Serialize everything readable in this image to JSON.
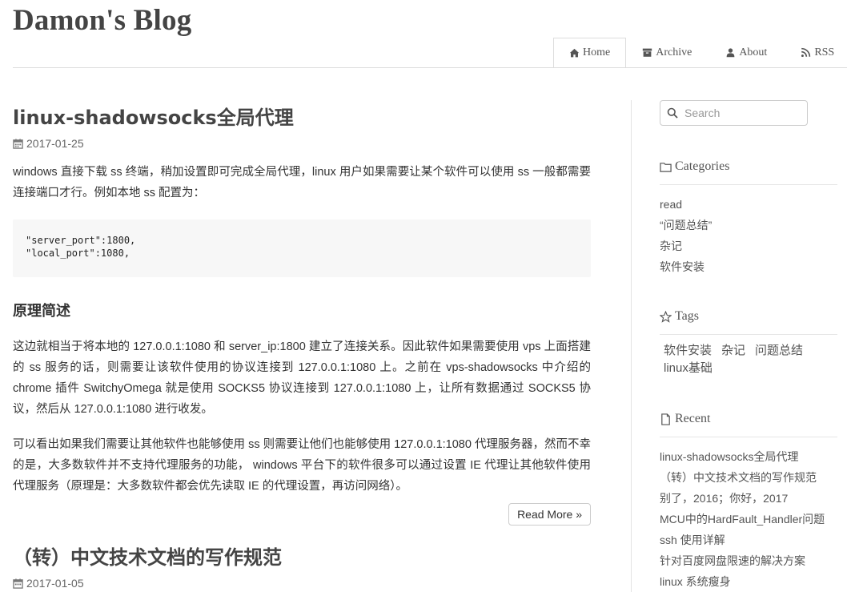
{
  "site": {
    "title": "Damon's Blog"
  },
  "nav": {
    "home": "Home",
    "archive": "Archive",
    "about": "About",
    "rss": "RSS"
  },
  "posts": [
    {
      "title": "linux-shadowsocks全局代理",
      "date": "2017-01-25",
      "intro": "windows 直接下载 ss 终端，稍加设置即可完成全局代理，linux 用户如果需要让某个软件可以使用 ss 一般都需要连接端口才行。例如本地 ss 配置为：",
      "code": "\"server_port\":1800,\n\"local_port\":1080,",
      "section_heading": "原理简述",
      "para2": "这边就相当于将本地的 127.0.0.1:1080 和 server_ip:1800 建立了连接关系。因此软件如果需要使用 vps 上面搭建的 ss 服务的话，则需要让该软件使用的协议连接到 127.0.0.1:1080 上。之前在 vps-shadowsocks 中介绍的 chrome 插件 SwitchyOmega 就是使用 SOCKS5 协议连接到 127.0.0.1:1080 上，让所有数据通过 SOCKS5 协议，然后从 127.0.0.1:1080 进行收发。",
      "para3": "可以看出如果我们需要让其他软件也能够使用 ss 则需要让他们也能够使用 127.0.0.1:1080 代理服务器，然而不幸的是，大多数软件并不支持代理服务的功能， windows 平台下的软件很多可以通过设置 IE 代理让其他软件使用代理服务（原理是：大多数软件都会优先读取 IE 的代理设置，再访问网络）。",
      "read_more": "Read More »"
    },
    {
      "title": "（转）中文技术文档的写作规范",
      "date": "2017-01-05"
    }
  ],
  "sidebar": {
    "search_placeholder": "Search",
    "categories_heading": "Categories",
    "categories": [
      "read",
      "“问题总结”",
      "杂记",
      "软件安装"
    ],
    "tags_heading": "Tags",
    "tags": [
      "软件安装",
      "杂记",
      "问题总结",
      "linux基础"
    ],
    "recent_heading": "Recent",
    "recent": [
      "linux-shadowsocks全局代理",
      "（转）中文技术文档的写作规范",
      "别了，2016；你好，2017",
      "MCU中的HardFault_Handler问题",
      "ssh 使用详解",
      "针对百度网盘限速的解决方案",
      "linux 系统瘦身"
    ]
  }
}
